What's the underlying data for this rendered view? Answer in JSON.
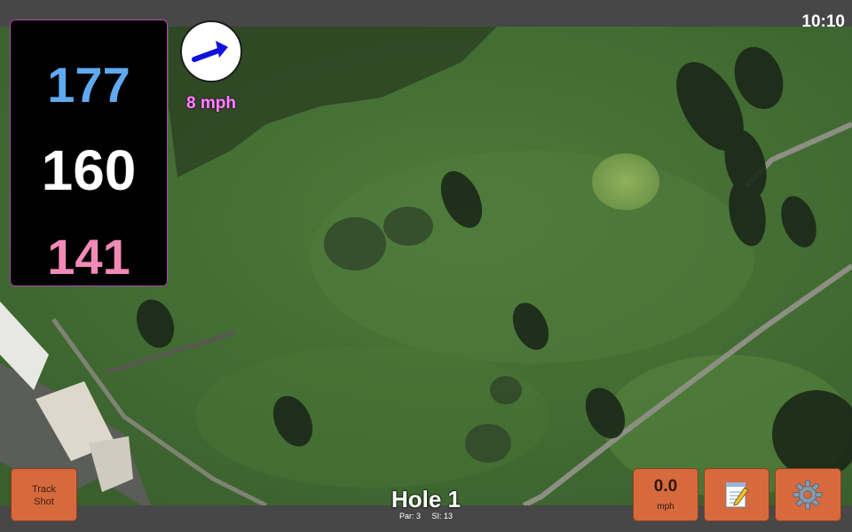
{
  "status": {
    "time": "10:10"
  },
  "distances": {
    "back": "177",
    "middle": "160",
    "front": "141"
  },
  "wind": {
    "speed": "8 mph",
    "icon": "arrow-right-icon",
    "color": "#1010e0"
  },
  "hole": {
    "title": "Hole 1",
    "par": "Par: 3",
    "stroke_index": "SI: 13"
  },
  "buttons": {
    "track_shot_line1": "Track",
    "track_shot_line2": "Shot",
    "speed_value": "0.0",
    "speed_unit": "mph",
    "notes_icon": "notepad-icon",
    "settings_icon": "gear-icon"
  },
  "colors": {
    "accent_button": "#d66a3d",
    "distance_back": "#5fa9f0",
    "distance_middle": "#ffffff",
    "distance_front": "#f28ab8",
    "wind_text": "#ff84ff"
  }
}
